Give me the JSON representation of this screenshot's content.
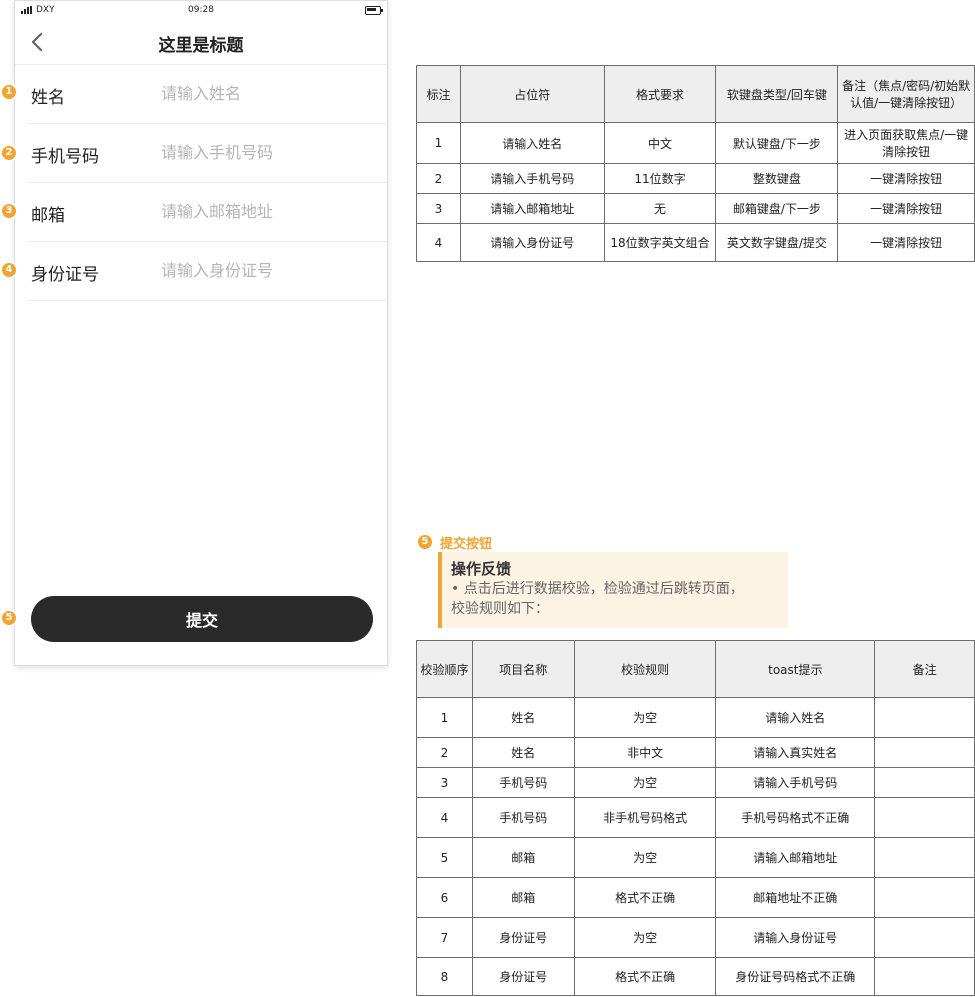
{
  "statusbar": {
    "carrier": "DXY",
    "time": "09:28"
  },
  "navbar": {
    "title": "这里是标题"
  },
  "form": {
    "fields": [
      {
        "marker": "1",
        "label": "姓名",
        "placeholder": "请输入姓名"
      },
      {
        "marker": "2",
        "label": "手机号码",
        "placeholder": "请输入手机号码"
      },
      {
        "marker": "3",
        "label": "邮箱",
        "placeholder": "请输入邮箱地址"
      },
      {
        "marker": "4",
        "label": "身份证号",
        "placeholder": "请输入身份证号"
      }
    ],
    "submit_marker": "5",
    "submit_label": "提交"
  },
  "input_table": {
    "headers": [
      "标注",
      "占位符",
      "格式要求",
      "软键盘类型/回车键",
      "备注（焦点/密码/初始默认值/一键清除按钮）"
    ],
    "rows": [
      [
        "1",
        "请输入姓名",
        "中文",
        "默认键盘/下一步",
        "进入页面获取焦点/一键清除按钮"
      ],
      [
        "2",
        "请输入手机号码",
        "11位数字",
        "整数键盘",
        "一键清除按钮"
      ],
      [
        "3",
        "请输入邮箱地址",
        "无",
        "邮箱键盘/下一步",
        "一键清除按钮"
      ],
      [
        "4",
        "请输入身份证号",
        "18位数字英文组合",
        "英文数字键盘/提交",
        "一键清除按钮"
      ]
    ]
  },
  "submit_note": {
    "marker": "5",
    "title": "提交按钮",
    "heading": "操作反馈",
    "line1": "• 点击后进行数据校验，检验通过后跳转页面，",
    "line2": "校验规则如下："
  },
  "validation_table": {
    "headers": [
      "校验顺序",
      "项目名称",
      "校验规则",
      "toast提示",
      "备注"
    ],
    "rows": [
      [
        "1",
        "姓名",
        "为空",
        "请输入姓名",
        ""
      ],
      [
        "2",
        "姓名",
        "非中文",
        "请输入真实姓名",
        ""
      ],
      [
        "3",
        "手机号码",
        "为空",
        "请输入手机号码",
        ""
      ],
      [
        "4",
        "手机号码",
        "非手机号码格式",
        "手机号码格式不正确",
        ""
      ],
      [
        "5",
        "邮箱",
        "为空",
        "请输入邮箱地址",
        ""
      ],
      [
        "6",
        "邮箱",
        "格式不正确",
        "邮箱地址不正确",
        ""
      ],
      [
        "7",
        "身份证号",
        "为空",
        "请输入身份证号",
        ""
      ],
      [
        "8",
        "身份证号",
        "格式不正确",
        "身份证号码格式不正确",
        ""
      ]
    ]
  },
  "colors": {
    "accent": "#f0a431",
    "button": "#2a2a2a",
    "note_bg": "#fdf3e4"
  }
}
